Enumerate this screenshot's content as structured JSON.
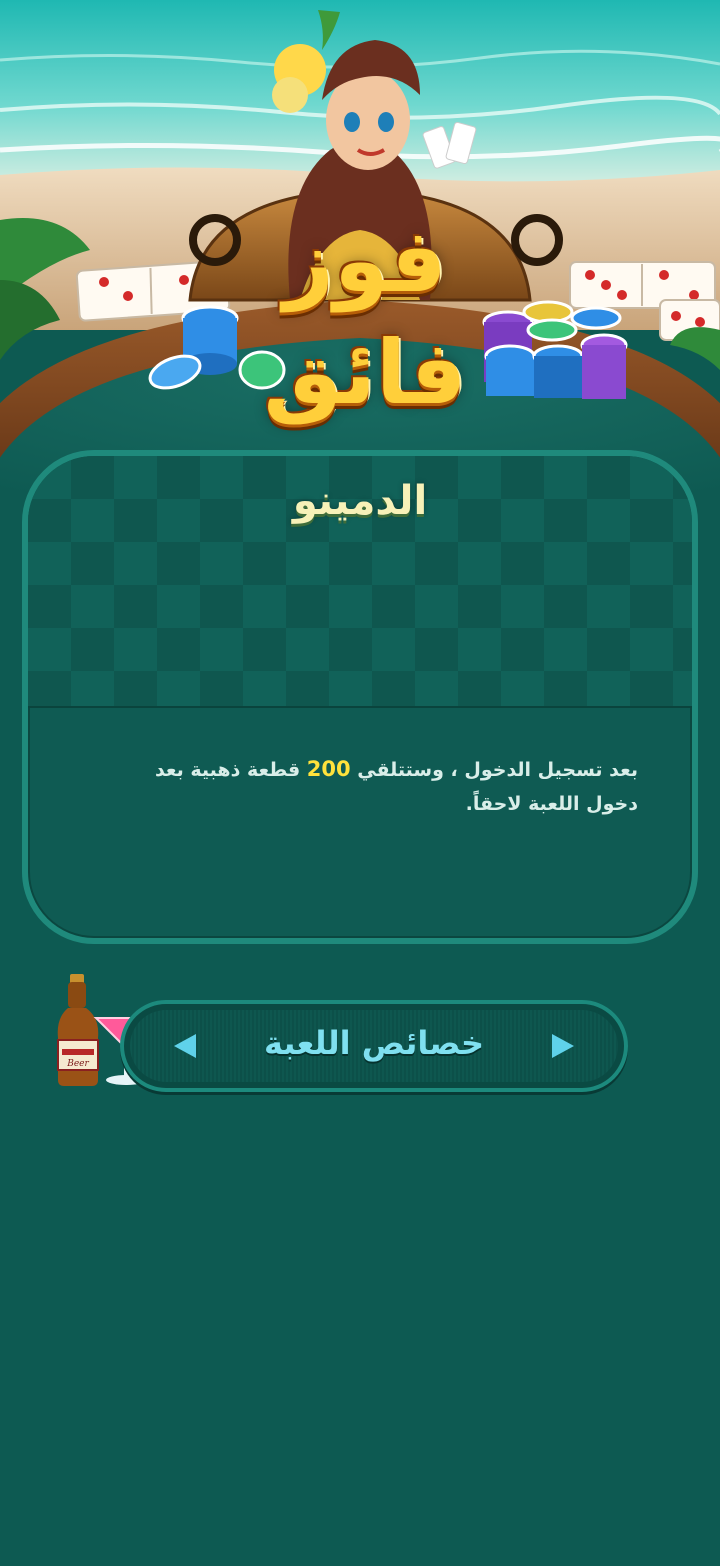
{
  "logo": {
    "line1": "فوز",
    "line2": "فائق"
  },
  "panel": {
    "title": "الدمينو",
    "body_before": "بعد تسجيل الدخول ، وستتلقي ",
    "body_amount": "200",
    "body_after": " قطعة ذهبية بعد دخول اللعبة لاحقاً."
  },
  "features": {
    "label": "خصائص اللعبة",
    "left_icon": "triangle-left-icon",
    "right_icon": "triangle-right-icon"
  },
  "decor": {
    "bottle_label": "Beer"
  },
  "colors": {
    "background": "#0d5a52",
    "panel_border": "#1f8a7c",
    "title": "#f7f1b8",
    "highlight": "#ffe23c",
    "feature_text": "#7fe0f0"
  }
}
